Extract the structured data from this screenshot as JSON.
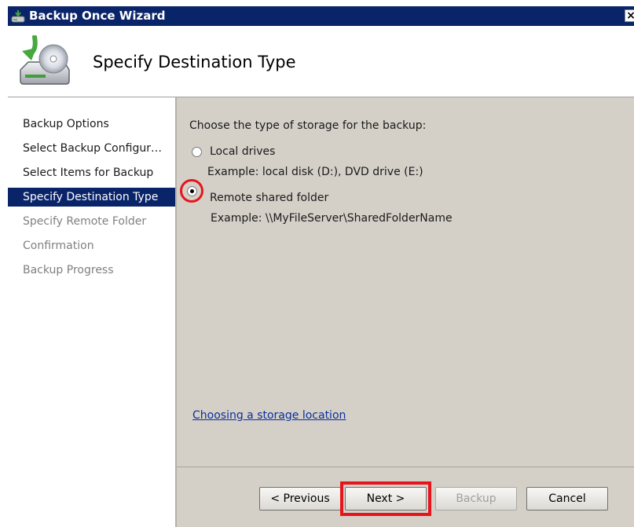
{
  "window": {
    "title": "Backup Once Wizard",
    "close_label": "×"
  },
  "header": {
    "title": "Specify Destination Type"
  },
  "sidebar": {
    "items": [
      {
        "label": "Backup Options",
        "state": "normal"
      },
      {
        "label": "Select Backup Configur…",
        "state": "normal"
      },
      {
        "label": "Select Items for Backup",
        "state": "normal"
      },
      {
        "label": "Specify Destination Type",
        "state": "active"
      },
      {
        "label": "Specify Remote Folder",
        "state": "disabled"
      },
      {
        "label": "Confirmation",
        "state": "disabled"
      },
      {
        "label": "Backup Progress",
        "state": "disabled"
      }
    ]
  },
  "main": {
    "prompt": "Choose the type of storage for the backup:",
    "options": [
      {
        "label": "Local drives",
        "example": "Example: local disk (D:), DVD drive (E:)",
        "selected": false
      },
      {
        "label": "Remote shared folder",
        "example": "Example: \\\\MyFileServer\\SharedFolderName",
        "selected": true
      }
    ],
    "help_link": "Choosing a storage location"
  },
  "buttons": {
    "previous": "< Previous",
    "next": "Next >",
    "backup": "Backup",
    "cancel": "Cancel"
  },
  "colors": {
    "title_bar": "#0a246a",
    "selection": "#0a246a",
    "highlight": "#e8141b",
    "link": "#0c2f9c"
  }
}
